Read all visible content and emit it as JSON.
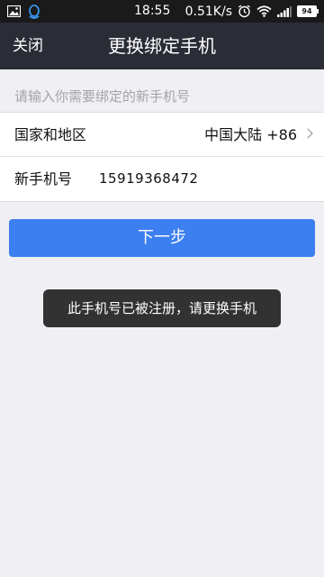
{
  "status_bar": {
    "time": "18:55",
    "network_speed": "0.51K/s",
    "battery_level": "94",
    "icons": [
      "image-icon",
      "qq-icon",
      "alarm-icon",
      "wifi-icon",
      "signal-icon",
      "battery-icon"
    ]
  },
  "nav": {
    "close_label": "关闭",
    "title": "更换绑定手机"
  },
  "hint": "请输入你需要绑定的新手机号",
  "form": {
    "region_label": "国家和地区",
    "region_value": "中国大陆 +86",
    "phone_label": "新手机号",
    "phone_value": "15919368472"
  },
  "next_button_label": "下一步",
  "toast_text": "此手机号已被注册，请更换手机",
  "colors": {
    "nav_bg": "#2a2c36",
    "button_bg": "#3c7ff0",
    "page_bg": "#efeff4",
    "status_bg": "#1a1a1a"
  }
}
